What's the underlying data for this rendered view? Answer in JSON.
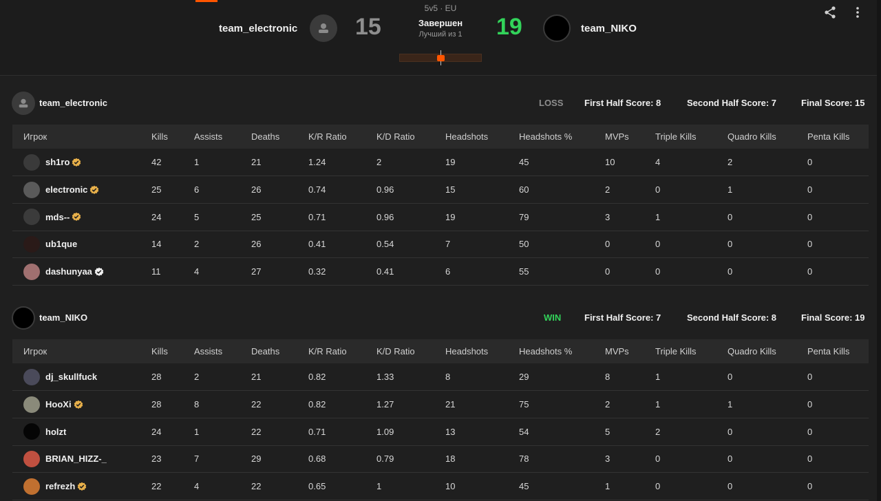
{
  "match": {
    "mode": "5v5 · EU",
    "status": "Завершен",
    "best_of": "Лучший из 1",
    "team1": {
      "name": "team_electronic",
      "score": "15"
    },
    "team2": {
      "name": "team_NIKO",
      "score": "19"
    }
  },
  "icons": {
    "share": "share-icon",
    "more": "more-vertical-icon"
  },
  "colors": {
    "accent": "#ff5500",
    "win": "#32d35a",
    "loss": "#8e8e8e",
    "verified_gold": "#e8b04a"
  },
  "columns": [
    "Игрок",
    "Kills",
    "Assists",
    "Deaths",
    "K/R Ratio",
    "K/D Ratio",
    "Headshots",
    "Headshots %",
    "MVPs",
    "Triple Kills",
    "Quadro Kills",
    "Penta Kills"
  ],
  "teams": [
    {
      "name": "team_electronic",
      "result": "LOSS",
      "first_half": "First Half Score: 8",
      "second_half": "Second Half Score: 7",
      "final": "Final Score: 15",
      "players": [
        {
          "name": "sh1ro",
          "badge": "gold",
          "stats": [
            "42",
            "1",
            "21",
            "1.24",
            "2",
            "19",
            "45",
            "10",
            "4",
            "2",
            "0"
          ]
        },
        {
          "name": "electronic",
          "badge": "gold",
          "stats": [
            "25",
            "6",
            "26",
            "0.74",
            "0.96",
            "15",
            "60",
            "2",
            "0",
            "1",
            "0"
          ]
        },
        {
          "name": "mds--",
          "badge": "gold",
          "stats": [
            "24",
            "5",
            "25",
            "0.71",
            "0.96",
            "19",
            "79",
            "3",
            "1",
            "0",
            "0"
          ]
        },
        {
          "name": "ub1que",
          "badge": "",
          "stats": [
            "14",
            "2",
            "26",
            "0.41",
            "0.54",
            "7",
            "50",
            "0",
            "0",
            "0",
            "0"
          ]
        },
        {
          "name": "dashunyaa",
          "badge": "white",
          "stats": [
            "11",
            "4",
            "27",
            "0.32",
            "0.41",
            "6",
            "55",
            "0",
            "0",
            "0",
            "0"
          ]
        }
      ]
    },
    {
      "name": "team_NIKO",
      "result": "WIN",
      "first_half": "First Half Score: 7",
      "second_half": "Second Half Score: 8",
      "final": "Final Score: 19",
      "players": [
        {
          "name": "dj_skullfuck",
          "badge": "",
          "stats": [
            "28",
            "2",
            "21",
            "0.82",
            "1.33",
            "8",
            "29",
            "8",
            "1",
            "0",
            "0"
          ]
        },
        {
          "name": "HooXi",
          "badge": "gold",
          "stats": [
            "28",
            "8",
            "22",
            "0.82",
            "1.27",
            "21",
            "75",
            "2",
            "1",
            "1",
            "0"
          ]
        },
        {
          "name": "holzt",
          "badge": "",
          "stats": [
            "24",
            "1",
            "22",
            "0.71",
            "1.09",
            "13",
            "54",
            "5",
            "2",
            "0",
            "0"
          ]
        },
        {
          "name": "BRIAN_HIZZ-_",
          "badge": "",
          "stats": [
            "23",
            "7",
            "29",
            "0.68",
            "0.79",
            "18",
            "78",
            "3",
            "0",
            "0",
            "0"
          ]
        },
        {
          "name": "refrezh",
          "badge": "gold",
          "stats": [
            "22",
            "4",
            "22",
            "0.65",
            "1",
            "10",
            "45",
            "1",
            "0",
            "0",
            "0"
          ]
        }
      ]
    }
  ]
}
